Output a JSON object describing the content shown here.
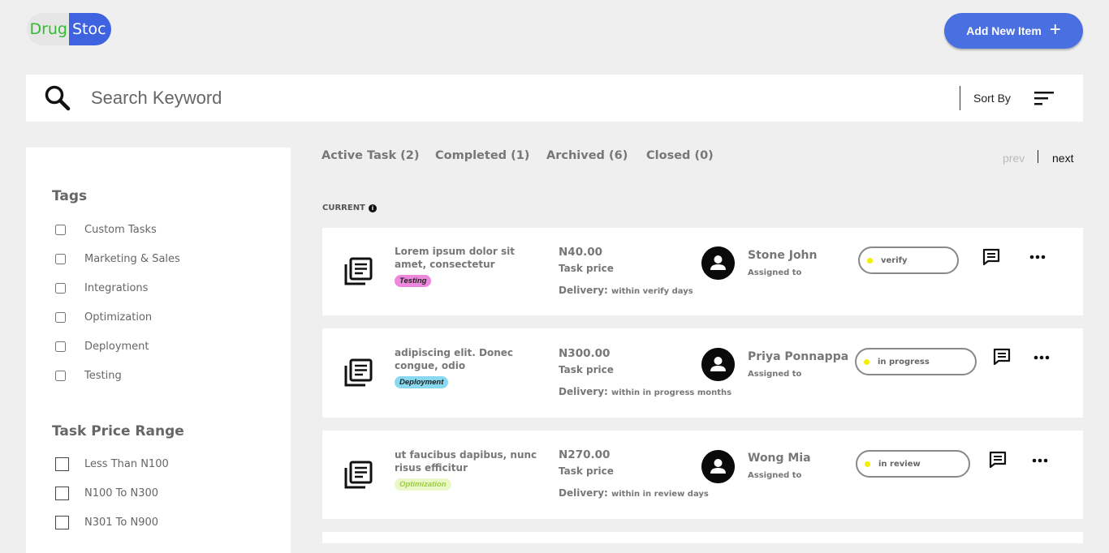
{
  "header": {
    "logo_part1": "Drug",
    "logo_part2": "Stoc",
    "add_button_label": "Add New Item"
  },
  "search": {
    "placeholder": "Search Keyword",
    "sort_label": "Sort By"
  },
  "sidebar": {
    "tags_heading": "Tags",
    "tags": [
      "Custom Tasks",
      "Marketing & Sales",
      "Integrations",
      "Optimization",
      "Deployment",
      "Testing"
    ],
    "price_heading": "Task Price Range",
    "price_ranges": [
      "Less Than N100",
      "N100 To N300",
      "N301 To N900"
    ]
  },
  "tabs": [
    {
      "label": "Active Task (2)"
    },
    {
      "label": "Completed (1)"
    },
    {
      "label": "Archived (6)"
    },
    {
      "label": "Closed (0)"
    }
  ],
  "pagination": {
    "prev": "prev",
    "next": "next"
  },
  "section_label": "CURRENT",
  "tasks": [
    {
      "title": "Lorem ipsum dolor sit amet, consectetur",
      "tag": "Testing",
      "tag_color": "#ee88dd",
      "price": "N40.00",
      "price_label": "Task price",
      "delivery_label": "Delivery:",
      "delivery_value": "within verify days",
      "assignee": "Stone John",
      "assigned_label": "Assigned to",
      "status": "verify"
    },
    {
      "title": "adipiscing elit. Donec congue, odio",
      "tag": "Deployment",
      "tag_color": "#88d8f0",
      "price": "N300.00",
      "price_label": "Task price",
      "delivery_label": "Delivery:",
      "delivery_value": "within in progress months",
      "assignee": "Priya Ponnappa",
      "assigned_label": "Assigned to",
      "status": "in progress"
    },
    {
      "title": "ut faucibus dapibus, nunc risus efficitur",
      "tag": "Optimization",
      "tag_color": "#eaf8c8",
      "price": "N270.00",
      "price_label": "Task price",
      "delivery_label": "Delivery:",
      "delivery_value": "within in review days",
      "assignee": "Wong Mia",
      "assigned_label": "Assigned to",
      "status": "in review"
    }
  ],
  "colors": {
    "brand_green": "#33bb33",
    "brand_blue": "#3f63e0",
    "accent_button": "#4a6fe0",
    "status_dot": "#f3f000"
  },
  "icons": {
    "search": "search-icon",
    "sort": "sort-icon",
    "task": "document-list-icon",
    "chat": "chat-icon",
    "more": "more-horizontal-icon",
    "avatar": "user-avatar-icon",
    "info": "info-icon"
  }
}
